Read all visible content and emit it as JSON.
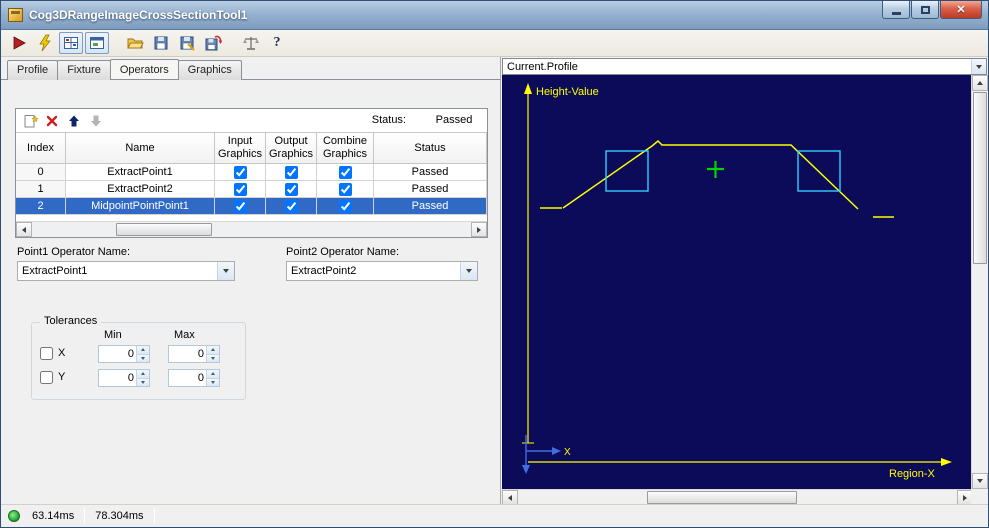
{
  "window": {
    "title": "Cog3DRangeImageCrossSectionTool1"
  },
  "toolbar": {
    "icons": [
      "run",
      "run-live",
      "grid-toggle",
      "window-toggle",
      "open-file",
      "save",
      "save-as",
      "save-import",
      "balance",
      "help"
    ],
    "help_glyph": "?"
  },
  "tabs": {
    "items": [
      {
        "label": "Profile",
        "active": false
      },
      {
        "label": "Fixture",
        "active": false
      },
      {
        "label": "Operators",
        "active": true
      },
      {
        "label": "Graphics",
        "active": false
      }
    ]
  },
  "operators_panel": {
    "toolbar": {
      "status_label": "Status:",
      "status_value": "Passed"
    },
    "grid": {
      "headers": {
        "index": "Index",
        "name": "Name",
        "input": "Input Graphics",
        "output": "Output Graphics",
        "combine": "Combine Graphics",
        "status": "Status"
      },
      "rows": [
        {
          "index": "0",
          "name": "ExtractPoint1",
          "input_graphics": true,
          "output_graphics": true,
          "combine_graphics": true,
          "status": "Passed",
          "selected": false
        },
        {
          "index": "1",
          "name": "ExtractPoint2",
          "input_graphics": true,
          "output_graphics": true,
          "combine_graphics": true,
          "status": "Passed",
          "selected": false
        },
        {
          "index": "2",
          "name": "MidpointPointPoint1",
          "input_graphics": true,
          "output_graphics": true,
          "combine_graphics": true,
          "status": "Passed",
          "selected": true
        }
      ]
    },
    "point1": {
      "label": "Point1 Operator Name:",
      "value": "ExtractPoint1"
    },
    "point2": {
      "label": "Point2 Operator Name:",
      "value": "ExtractPoint2"
    },
    "tolerances": {
      "title": "Tolerances",
      "min_header": "Min",
      "max_header": "Max",
      "rows": [
        {
          "label": "X",
          "enabled": false,
          "min": "0",
          "max": "0"
        },
        {
          "label": "Y",
          "enabled": false,
          "min": "0",
          "max": "0"
        }
      ]
    }
  },
  "display": {
    "selector_value": "Current.Profile",
    "y_axis_label": "Height-Value",
    "x_axis_label": "Region-X",
    "origin_label": "X",
    "colors": {
      "background": "#0b0b5a",
      "profile": "#ffff00",
      "search_region": "#33ccff",
      "result_marker": "#00d400",
      "axis": "#ffff00",
      "origin_axes": "#3f6fe0"
    }
  },
  "statusbar": {
    "time1": "63.14ms",
    "time2": "78.304ms"
  }
}
